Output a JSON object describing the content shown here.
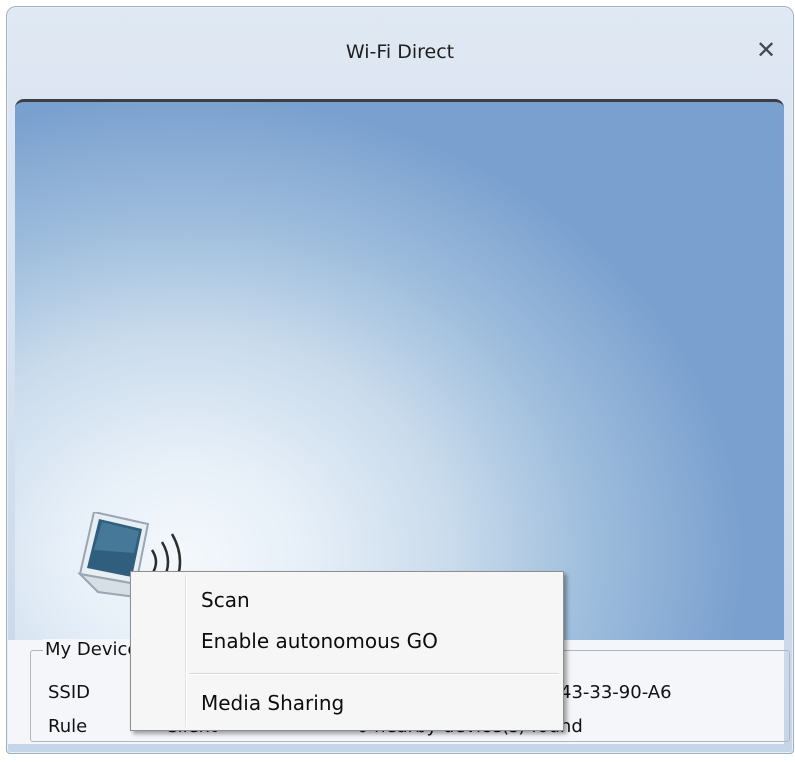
{
  "window": {
    "title": "Wi-Fi Direct",
    "close_label": "✕"
  },
  "device_panel": {
    "group_title": "My Device",
    "ssid_label": "SSID",
    "ssid_value": "",
    "mac_fragment": "43-33-90-A6",
    "rule_label": "Rule",
    "rule_value": "Client",
    "nearby_status": "0 nearby device(s) found"
  },
  "context_menu": {
    "items": [
      {
        "label": "Scan"
      },
      {
        "label": "Enable autonomous GO"
      },
      {
        "label": "Media Sharing"
      }
    ]
  },
  "icons": {
    "device": "laptop-wireless-icon",
    "close": "close-icon"
  },
  "colors": {
    "stage_top": "#7aa0cf",
    "stage_glow": "#f4f8fc",
    "menu_bg": "#f6f6f6",
    "titlebar": "#d2dfee"
  }
}
